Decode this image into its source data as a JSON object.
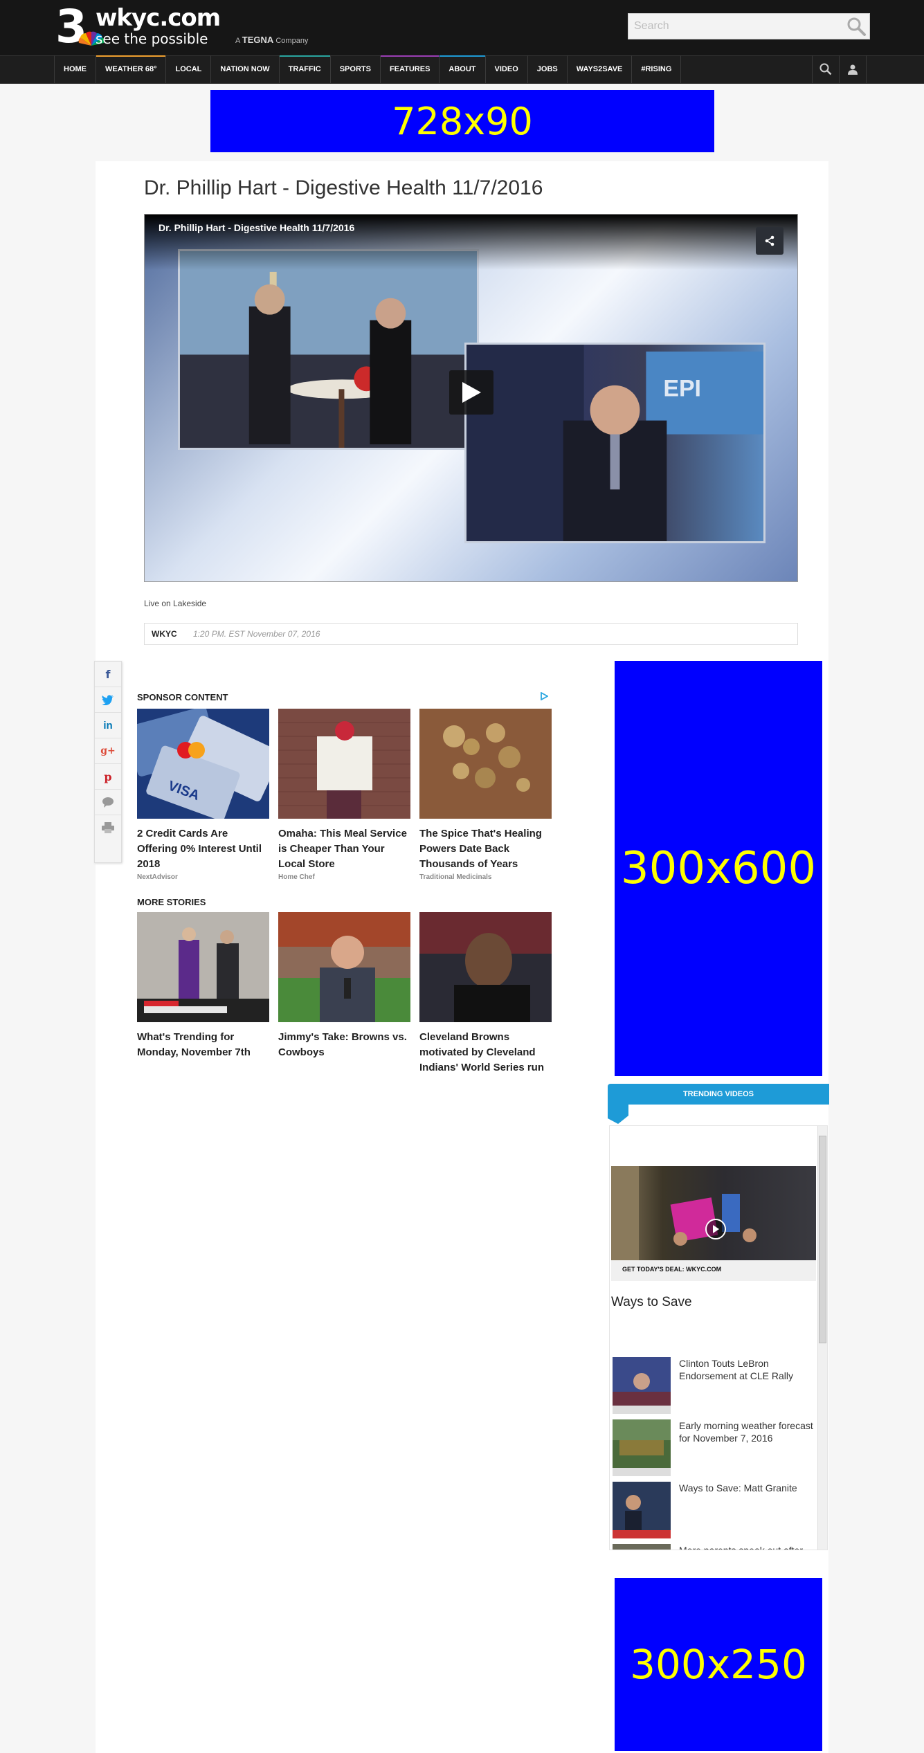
{
  "header": {
    "logo_number": "3",
    "logo_site": "wkyc.com",
    "logo_tagline": "see the possible",
    "logo_company_prefix": "A",
    "logo_company": "TEGNA",
    "logo_company_suffix": "Company",
    "search_placeholder": "Search",
    "search_value": ""
  },
  "nav": {
    "items": [
      {
        "label": "HOME",
        "accent": ""
      },
      {
        "label": "WEATHER 68°",
        "accent": "#f0a030"
      },
      {
        "label": "LOCAL",
        "accent": ""
      },
      {
        "label": "NATION NOW",
        "accent": ""
      },
      {
        "label": "TRAFFIC",
        "accent": "#2aa6a0"
      },
      {
        "label": "SPORTS",
        "accent": ""
      },
      {
        "label": "FEATURES",
        "accent": "#9b3fb5"
      },
      {
        "label": "ABOUT",
        "accent": "#1e9bd7"
      },
      {
        "label": "VIDEO",
        "accent": ""
      },
      {
        "label": "JOBS",
        "accent": ""
      },
      {
        "label": "WAYS2SAVE",
        "accent": ""
      },
      {
        "label": "#RISING",
        "accent": ""
      }
    ],
    "icons": [
      "search-icon",
      "user-icon"
    ]
  },
  "ads": {
    "top": "728x90",
    "right": "300x600",
    "bottom": "300x250"
  },
  "article": {
    "title": "Dr. Phillip Hart - Digestive Health 11/7/2016",
    "video_title": "Dr. Phillip Hart - Digestive Health 11/7/2016",
    "caption": "Live on Lakeside",
    "source": "WKYC",
    "timestamp": "1:20 PM. EST November 07, 2016"
  },
  "share_rail": [
    "facebook-icon",
    "twitter-icon",
    "linkedin-icon",
    "googleplus-icon",
    "pinterest-icon",
    "comment-icon",
    "print-icon"
  ],
  "sponsor": {
    "label": "SPONSOR CONTENT",
    "cards": [
      {
        "title": "2 Credit Cards Are Offering 0% Interest Until 2018",
        "source": "NextAdvisor"
      },
      {
        "title": "Omaha: This Meal Service is Cheaper Than Your Local Store",
        "source": "Home Chef"
      },
      {
        "title": "The Spice That's Healing Powers Date Back Thousands of Years",
        "source": "Traditional Medicinals"
      }
    ]
  },
  "more_stories": {
    "label": "MORE STORIES",
    "cards": [
      {
        "title": "What's Trending for Monday, November 7th"
      },
      {
        "title": "Jimmy's Take: Browns vs. Cowboys"
      },
      {
        "title": "Cleveland Browns motivated by Cleveland Indians' World Series run"
      }
    ]
  },
  "trending": {
    "banner": "TRENDING VIDEOS",
    "featured_title": "Ways to Save",
    "featured_strip": "GET TODAY'S DEAL: WKYC.COM",
    "items": [
      {
        "title": "Clinton Touts LeBron Endorsement at CLE Rally"
      },
      {
        "title": "Early morning weather forecast for November 7, 2016"
      },
      {
        "title": "Ways to Save: Matt Granite"
      },
      {
        "title": "More parents speak out after"
      }
    ]
  },
  "colors": {
    "header_bg": "#161616",
    "ad_fill": "#0000ff",
    "ad_text": "#ffff00",
    "trending_accent": "#1e9bd7"
  }
}
